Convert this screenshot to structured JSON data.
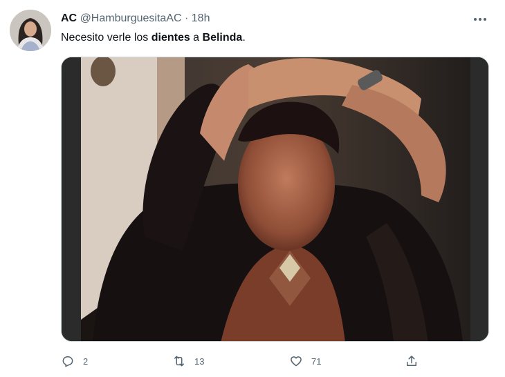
{
  "tweet": {
    "author_name": "AC",
    "author_handle": "@HamburguesitaAC",
    "separator": "·",
    "time": "18h",
    "text_parts": [
      "Necesito verle los ",
      "dientes",
      " a ",
      "Belinda",
      "."
    ]
  },
  "actions": {
    "reply_count": "2",
    "retweet_count": "13",
    "like_count": "71"
  },
  "icons": {
    "more": "more-icon",
    "reply": "reply-icon",
    "retweet": "retweet-icon",
    "like": "heart-icon",
    "share": "share-icon"
  },
  "colors": {
    "text_primary": "#0f1419",
    "text_secondary": "#536471",
    "border": "#cfd9de"
  }
}
